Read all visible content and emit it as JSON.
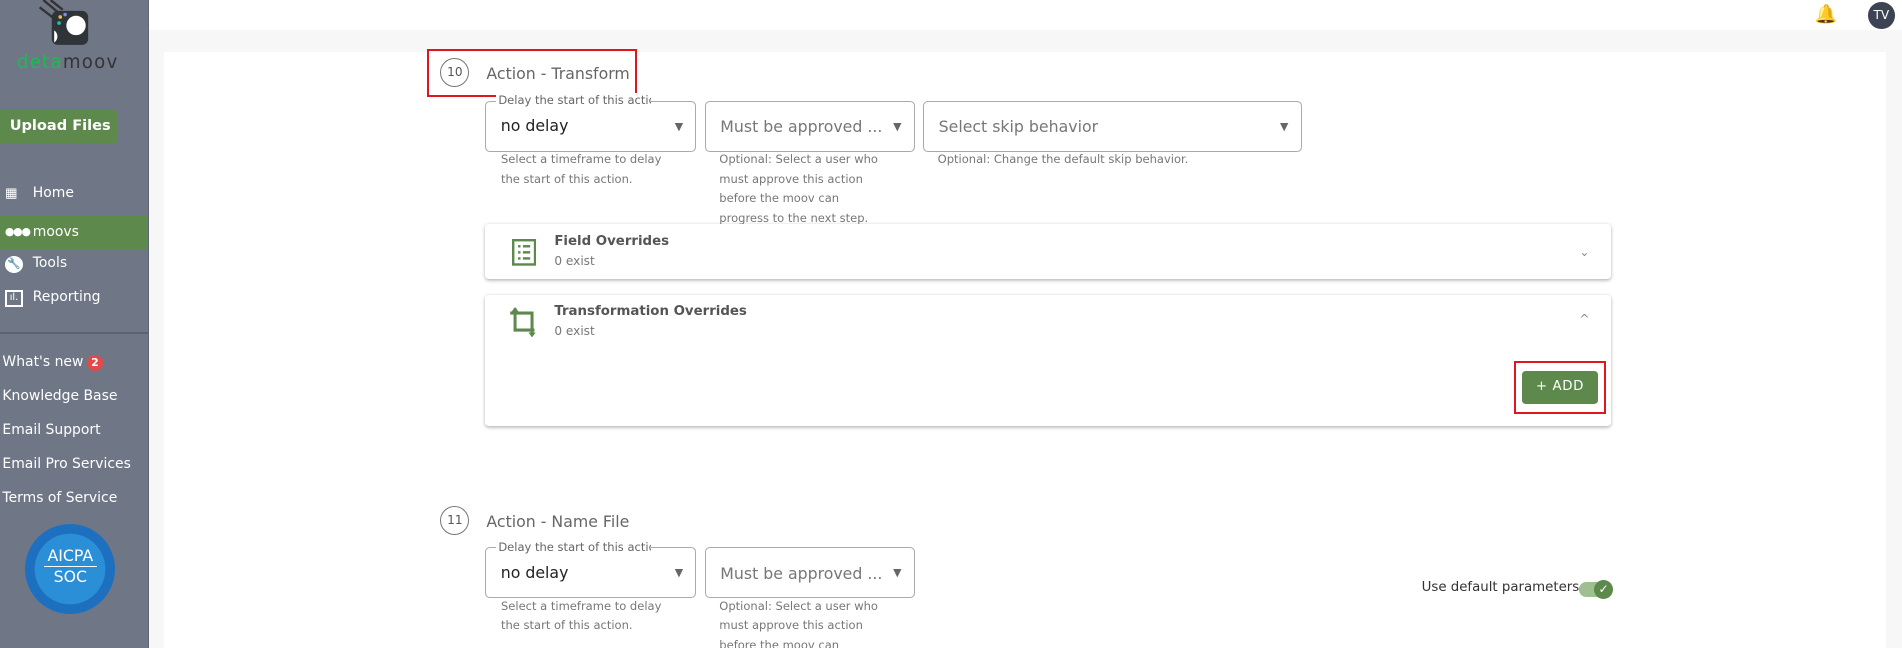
{
  "sidebar": {
    "logo": {
      "part1": "deta",
      "part2": "moov",
      "color1": "#1db954",
      "color2": "#333"
    },
    "upload_label": "Upload Files",
    "nav": [
      {
        "label": "Home",
        "icon": "dashboard-icon"
      },
      {
        "label": "moovs",
        "icon": "dots-icon",
        "active": true
      },
      {
        "label": "Tools",
        "icon": "wrench-icon"
      },
      {
        "label": "Reporting",
        "icon": "chart-icon"
      }
    ],
    "links": [
      {
        "label": "What's new",
        "badge": "2"
      },
      {
        "label": "Knowledge Base"
      },
      {
        "label": "Email Support"
      },
      {
        "label": "Email Pro Services"
      },
      {
        "label": "Terms of Service"
      }
    ],
    "cert": {
      "line1": "AICPA",
      "line2": "SOC"
    }
  },
  "header": {
    "avatar": "TV",
    "bell": "bell-plus-icon"
  },
  "steps": [
    {
      "number": "10",
      "title": "Action - Transform",
      "delay": {
        "label": "Delay the start of this action",
        "value": "no delay",
        "help": [
          "Select a timeframe to delay",
          "the start of this action."
        ]
      },
      "approve": {
        "placeholder": "Must be approved ...",
        "help": [
          "Optional: Select a user who",
          "must approve this action",
          "before the moov can",
          "progress to the next step."
        ]
      },
      "skip": {
        "placeholder": "Select skip behavior",
        "help": "Optional: Change the default skip behavior."
      },
      "panels": [
        {
          "title": "Field Overrides",
          "sub": "0 exist"
        },
        {
          "title": "Transformation Overrides",
          "sub": "0 exist",
          "add_label": "+ ADD"
        }
      ]
    },
    {
      "number": "11",
      "title": "Action - Name File",
      "delay": {
        "label": "Delay the start of this action",
        "value": "no delay",
        "help": [
          "Select a timeframe to delay",
          "the start of this action."
        ]
      },
      "approve": {
        "placeholder": "Must be approved ...",
        "help": [
          "Optional: Select a user who",
          "must approve this action",
          "before the moov can"
        ]
      },
      "toggle": {
        "label": "Use default parameters",
        "on": true
      }
    }
  ],
  "colors": {
    "accent": "#5d8a4c",
    "sidebar": "#6f7786",
    "highlight": "#e0161f"
  }
}
